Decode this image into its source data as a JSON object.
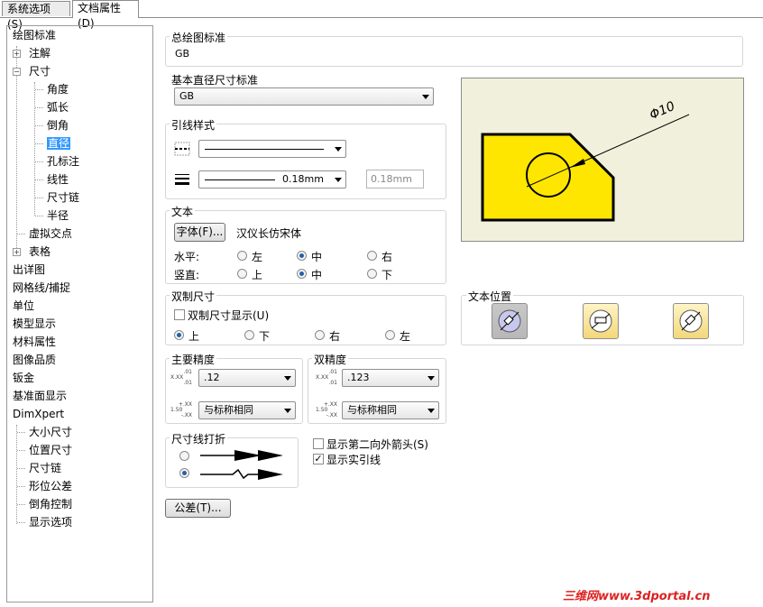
{
  "tabs": [
    {
      "label": "系统选项(S)"
    },
    {
      "label": "文档属性(D)"
    }
  ],
  "tree": [
    {
      "label": "绘图标准"
    },
    {
      "label": "注解"
    },
    {
      "label": "尺寸"
    },
    {
      "label": "角度"
    },
    {
      "label": "弧长"
    },
    {
      "label": "倒角"
    },
    {
      "label": "直径"
    },
    {
      "label": "孔标注"
    },
    {
      "label": "线性"
    },
    {
      "label": "尺寸链"
    },
    {
      "label": "半径"
    },
    {
      "label": "虚拟交点"
    },
    {
      "label": "表格"
    },
    {
      "label": "出详图"
    },
    {
      "label": "网格线/捕捉"
    },
    {
      "label": "单位"
    },
    {
      "label": "模型显示"
    },
    {
      "label": "材料属性"
    },
    {
      "label": "图像品质"
    },
    {
      "label": "钣金"
    },
    {
      "label": "基准面显示"
    },
    {
      "label": "DimXpert"
    },
    {
      "label": "大小尺寸"
    },
    {
      "label": "位置尺寸"
    },
    {
      "label": "尺寸链"
    },
    {
      "label": "形位公差"
    },
    {
      "label": "倒角控制"
    },
    {
      "label": "显示选项"
    }
  ],
  "overall_standard": {
    "title": "总绘图标准",
    "value": "GB"
  },
  "base_standard": {
    "title": "基本直径尺寸标准",
    "value": "GB"
  },
  "leader_style": {
    "title": "引线样式",
    "thickness": "0.18mm",
    "thickness_field": "0.18mm"
  },
  "text": {
    "title": "文本",
    "font_button": "字体(F)...",
    "font_name": "汉仪长仿宋体",
    "horizontal_label": "水平:",
    "vertical_label": "竖直:",
    "h_left": "左",
    "h_center": "中",
    "h_right": "右",
    "v_top": "上",
    "v_center": "中",
    "v_bottom": "下"
  },
  "dual": {
    "title": "双制尺寸",
    "show_label": "双制尺寸显示(U)",
    "up": "上",
    "down": "下",
    "right": "右",
    "left": "左"
  },
  "text_position": {
    "title": "文本位置"
  },
  "primary_precision": {
    "title": "主要精度",
    "value": ".12",
    "tolerance": "与标称相同"
  },
  "dual_precision": {
    "title": "双精度",
    "value": ".123",
    "tolerance": "与标称相同"
  },
  "dim_break": {
    "title": "尺寸线打折"
  },
  "options": {
    "second_arrow": "显示第二向外箭头(S)",
    "show_leader": "显示实引线"
  },
  "tolerance_button": "公差(T)...",
  "preview": {
    "dim_text": "Φ10"
  },
  "precision_icons": {
    "a_top": ".01",
    "a_mid": "X.XX",
    "a_bot": ".01",
    "b_top": "+.XX",
    "b_mid": "1.50",
    "b_bot": "-.XX"
  },
  "watermark": "三维网www.3dportal.cn",
  "colors": {
    "selection": "#3399ff",
    "preview_bg": "#f0f0dc",
    "part_fill": "#ffe600",
    "watermark": "#e02020"
  }
}
